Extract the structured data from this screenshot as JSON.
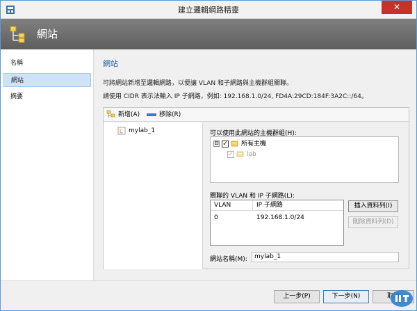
{
  "window": {
    "title": "建立邏輯網路精靈",
    "close_glyph": "✕"
  },
  "header": {
    "title": "網站",
    "icon": "site-hierarchy-icon"
  },
  "nav": {
    "items": [
      {
        "label": "名稱",
        "active": false
      },
      {
        "label": "網站",
        "active": true
      },
      {
        "label": "摘要",
        "active": false
      }
    ]
  },
  "content": {
    "section_title": "網站",
    "description": "可將網站新增至邏輯網路，以便讓 VLAN 和子網路與主機群組關聯。",
    "cidr_hint": "請使用 CIDR 表示法輸入 IP 子網路，例如: 192.168.1.0/24, FD4A:29CD:184F:3A2C::/64。"
  },
  "toolbar": {
    "add_label": "新增(A)",
    "remove_label": "移除(R)"
  },
  "sites": {
    "items": [
      "mylab_1"
    ]
  },
  "host_groups": {
    "label": "可以使用此網站的主機群組(H):",
    "root": {
      "label": "所有主機",
      "expander": "⊟",
      "checked": true
    },
    "children": [
      {
        "label": "lab",
        "checked": true
      }
    ],
    "check_glyph": "✓"
  },
  "vlan": {
    "label": "關聯的 VLAN 和 IP 子網路(L):",
    "columns": [
      "VLAN",
      "IP 子網路"
    ],
    "rows": [
      {
        "vlan": "0",
        "subnet": "192.168.1.0/24"
      }
    ],
    "insert_label": "插入資料列(I)",
    "delete_label": "刪除資料列(D)"
  },
  "site_name": {
    "label": "網站名稱(M):",
    "value": "mylab_1"
  },
  "footer": {
    "back_label": "上一步(P)",
    "next_label": "下一步(N)",
    "cancel_label": "取消"
  },
  "colors": {
    "accent": "#1f5fa8",
    "close": "#c7302b",
    "header_bg": "#6e6e6e",
    "nav_active": "#cfe3f7"
  }
}
